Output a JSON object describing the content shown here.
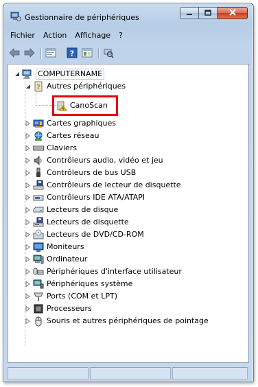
{
  "window": {
    "title": "Gestionnaire de périphériques"
  },
  "menubar": {
    "items": [
      {
        "label": "Fichier"
      },
      {
        "label": "Action"
      },
      {
        "label": "Affichage"
      },
      {
        "label": "?"
      }
    ]
  },
  "toolbar": {
    "buttons": [
      "back-arrow-icon",
      "forward-arrow-icon",
      "properties-icon",
      "help-icon",
      "show-hidden-icon",
      "scan-hardware-icon"
    ]
  },
  "tree": {
    "root": {
      "label": "COMPUTERNAME",
      "icon": "computer-icon"
    },
    "other_devices": {
      "label": "Autres périphériques",
      "icon": "unknown-device-icon"
    },
    "selected_device": {
      "label": "CanoScan",
      "icon": "warning-device-icon"
    },
    "categories": [
      {
        "label": "Cartes graphiques",
        "icon": "display-adapter-icon"
      },
      {
        "label": "Cartes réseau",
        "icon": "network-adapter-icon"
      },
      {
        "label": "Claviers",
        "icon": "keyboard-icon"
      },
      {
        "label": "Contrôleurs audio, vidéo et jeu",
        "icon": "speaker-icon"
      },
      {
        "label": "Contrôleurs de bus USB",
        "icon": "usb-icon"
      },
      {
        "label": "Contrôleurs de lecteur de disquette",
        "icon": "floppy-controller-icon"
      },
      {
        "label": "Contrôleurs IDE ATA/ATAPI",
        "icon": "ide-controller-icon"
      },
      {
        "label": "Lecteurs de disque",
        "icon": "disk-drive-icon"
      },
      {
        "label": "Lecteurs de disquette",
        "icon": "floppy-drive-icon"
      },
      {
        "label": "Lecteurs de DVD/CD-ROM",
        "icon": "dvd-drive-icon"
      },
      {
        "label": "Moniteurs",
        "icon": "monitor-icon"
      },
      {
        "label": "Ordinateur",
        "icon": "computer-small-icon"
      },
      {
        "label": "Périphériques d'interface utilisateur",
        "icon": "hid-icon"
      },
      {
        "label": "Périphériques système",
        "icon": "system-device-icon"
      },
      {
        "label": "Ports (COM et LPT)",
        "icon": "port-icon"
      },
      {
        "label": "Processeurs",
        "icon": "processor-icon"
      },
      {
        "label": "Souris et autres périphériques de pointage",
        "icon": "mouse-icon"
      }
    ]
  },
  "colors": {
    "highlight_box": "#e8000d",
    "window_frame": "#bfd3ea"
  }
}
